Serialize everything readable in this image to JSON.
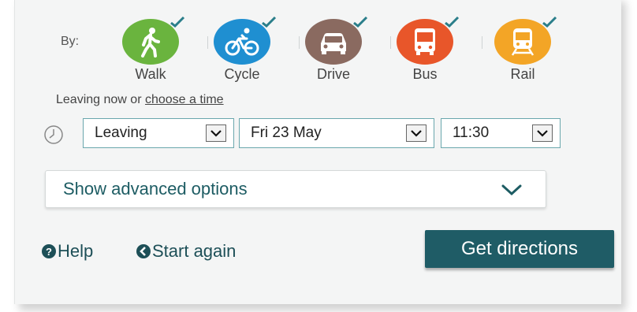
{
  "journey": {
    "by_label": "By:",
    "modes": [
      {
        "label": "Walk",
        "color": "#6ab43e",
        "icon": "walk-icon",
        "selected": true
      },
      {
        "label": "Cycle",
        "color": "#1f8fd1",
        "icon": "cycle-icon",
        "selected": true
      },
      {
        "label": "Drive",
        "color": "#8a6a60",
        "icon": "car-icon",
        "selected": true
      },
      {
        "label": "Bus",
        "color": "#e8562a",
        "icon": "bus-icon",
        "selected": true
      },
      {
        "label": "Rail",
        "color": "#f3a526",
        "icon": "train-icon",
        "selected": true
      }
    ],
    "leaving_prefix": "Leaving now or ",
    "choose_time_link": "choose a time",
    "leave_type": "Leaving",
    "date": "Fri 23 May",
    "time": "11:30",
    "advanced_label": "Show advanced options",
    "help_label": "Help",
    "start_again_label": "Start again",
    "get_directions_label": "Get directions"
  },
  "colors": {
    "accent": "#1f5c66",
    "check": "#2a7e8a",
    "select_border": "#6aa7ad"
  }
}
